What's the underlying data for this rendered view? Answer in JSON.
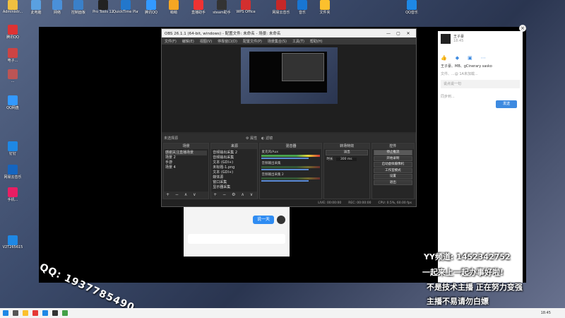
{
  "desktop": {
    "icons_left": [
      "Administr...",
      "此电脑",
      "回收站",
      "腾讯QQ",
      "电子...",
      "作品...",
      "QQ网盘",
      "...",
      "钉钉",
      "网易云音乐",
      "手机...",
      "...",
      "V2T265615"
    ],
    "icons_top": [
      "此电脑",
      "网络",
      "控制面板",
      "Pro Tools 12",
      "QuickTime Player",
      "腾讯QQ",
      "萌萌",
      "直播助手",
      "steam助手",
      "WPS Office",
      "网易云音乐",
      "音乐",
      "文件夹",
      "",
      "",
      "QQ音乐"
    ]
  },
  "obs": {
    "title": "OBS 26.1.1 (64-bit, windows) - 配置文件: 未命名 - 场景: 未命名",
    "menu": [
      "文件(F)",
      "编辑(E)",
      "视图(V)",
      "停靠窗口(D)",
      "配置文件(P)",
      "场景集合(S)",
      "工具(T)",
      "帮助(H)"
    ],
    "bar_label": "未选择源",
    "bar_props": "属性",
    "bar_filters": "滤镜",
    "docks": {
      "scenes": {
        "title": "场景",
        "items": [
          "感谢关注直播场景",
          "场景 2",
          "手游",
          "场景 4"
        ]
      },
      "sources": {
        "title": "来源",
        "items": [
          "音频输出采集 2",
          "音频输出采集",
          "文本 (GDI+)",
          "未标题-1.png",
          "文本 (GDI+)",
          "媒体源",
          "窗口采集",
          "显示器采集"
        ]
      },
      "mixer": {
        "title": "混音器",
        "channels": [
          "麦克风/Aux",
          "音频输出采集",
          "音频输出采集 2"
        ]
      },
      "transitions": {
        "title": "转场特效",
        "type": "淡出",
        "duration_label": "时长",
        "duration": "300 ms"
      },
      "controls": {
        "title": "控件",
        "buttons": [
          "停止推流",
          "开始录制",
          "启动虚拟摄像机",
          "工作室模式",
          "设置",
          "退出"
        ]
      }
    },
    "status": {
      "live": "LIVE: 00:00:00",
      "rec": "REC: 00:00:00",
      "cpu": "CPU: 0.5%, 60.00 fps"
    }
  },
  "chat": {
    "name": "王子豪",
    "time": "18:45",
    "preview": "王子豪、MB、gCinerary sasko",
    "subtitle": "文件、...@ 1A未加载...",
    "input_placeholder": "说点说一句",
    "checkbox_label": "同步到...",
    "send": "发送"
  },
  "phone": {
    "bubble": "说一天"
  },
  "overlay": {
    "yy_line": "YY频道: 1452342752",
    "line2": "一起来上一起办事好啦!",
    "line3": "不是技术主播 正在努力变强",
    "line4": "主播不易请勿白嫖",
    "qq": "QQ: 1937785490"
  },
  "taskbar": {
    "time": "18:45"
  }
}
